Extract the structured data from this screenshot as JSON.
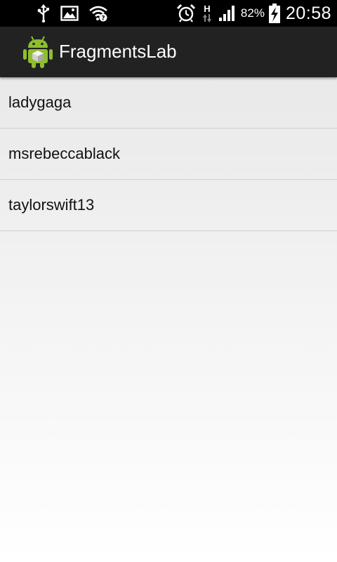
{
  "status_bar": {
    "icons_left": [
      "usb-icon",
      "image-notification-icon",
      "wifi-icon"
    ],
    "icons_right": [
      "alarm-icon",
      "hspa-data-icon",
      "signal-icon",
      "battery-charging-icon"
    ],
    "battery_percent": "82%",
    "time": "20:58",
    "network_type": "H"
  },
  "action_bar": {
    "icon": "android-app-icon",
    "title": "FragmentsLab"
  },
  "list": {
    "items": [
      {
        "label": "ladygaga"
      },
      {
        "label": "msrebeccablack"
      },
      {
        "label": "taylorswift13"
      }
    ]
  },
  "colors": {
    "status_bar_bg": "#000000",
    "action_bar_bg": "#222222",
    "list_bg_top": "#e9e9e9",
    "divider": "#cfcfcf",
    "android_green": "#8fbf2f"
  }
}
